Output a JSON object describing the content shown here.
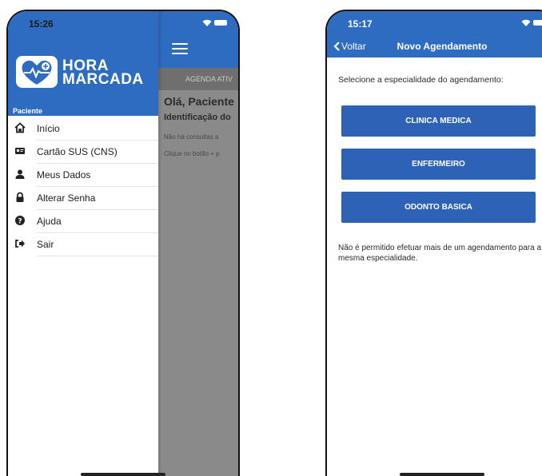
{
  "left_screen": {
    "status": {
      "time": "15:26"
    },
    "app_name_line1": "HORA",
    "app_name_line2": "MARCADA",
    "section_label": "Paciente",
    "menu": [
      {
        "icon": "home-icon",
        "label": "Início"
      },
      {
        "icon": "id-card-icon",
        "label": "Cartão SUS (CNS)"
      },
      {
        "icon": "user-icon",
        "label": "Meus Dados"
      },
      {
        "icon": "lock-icon",
        "label": "Alterar Senha"
      },
      {
        "icon": "help-icon",
        "label": "Ajuda"
      },
      {
        "icon": "sign-out-icon",
        "label": "Sair"
      }
    ],
    "background": {
      "tab_label": "AGENDA ATIV",
      "greeting": "Olá, Paciente",
      "subheading": "Identificação do",
      "empty_text": "Não há consultas a",
      "hint_text": "Clique no botão + p"
    }
  },
  "right_screen": {
    "status": {
      "time": "15:17"
    },
    "back_label": "Voltar",
    "title": "Novo Agendamento",
    "prompt": "Selecione a especialidade do agendamento:",
    "specialties": [
      "CLINICA MEDICA",
      "ENFERMEIRO",
      "ODONTO BASICA"
    ],
    "note": "Não é permitido efetuar mais de um agendamento para a mesma especialidade."
  },
  "colors": {
    "primary": "#2d6cc0",
    "button": "#2d62b6",
    "overlay": "#8a8a8a"
  }
}
